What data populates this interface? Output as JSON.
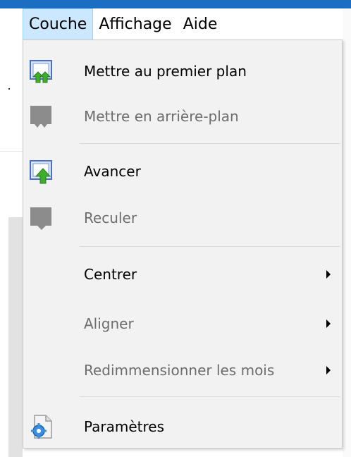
{
  "menubar": {
    "items": [
      {
        "label": "Couche",
        "active": true
      },
      {
        "label": "Affichage",
        "active": false
      },
      {
        "label": "Aide",
        "active": false
      }
    ]
  },
  "menu": {
    "items": [
      {
        "label": "Mettre au premier plan",
        "enabled": true,
        "icon": "bring-to-front-icon"
      },
      {
        "label": "Mettre en arrière-plan",
        "enabled": false,
        "icon": "send-to-back-icon"
      },
      {
        "label": "Avancer",
        "enabled": true,
        "icon": "bring-forward-icon"
      },
      {
        "label": "Reculer",
        "enabled": false,
        "icon": "send-backward-icon"
      },
      {
        "label": "Centrer",
        "enabled": true,
        "submenu": true
      },
      {
        "label": "Aligner",
        "enabled": false,
        "submenu": true
      },
      {
        "label": "Redimmensionner les mois",
        "enabled": false,
        "submenu": true
      },
      {
        "label": "Paramètres",
        "enabled": true,
        "icon": "settings-icon"
      }
    ]
  },
  "colors": {
    "accent_blue": "#1b6ec2",
    "menu_bg": "#f2f2f2",
    "active_menubar": "#cce8ff",
    "disabled_text": "#6d6d6d",
    "icon_green": "#3fae2a"
  }
}
